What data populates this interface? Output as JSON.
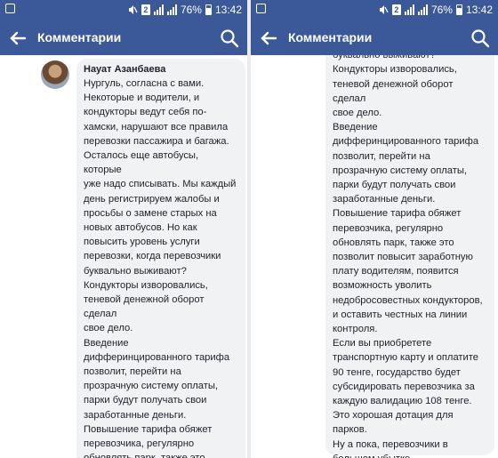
{
  "status": {
    "battery": "76%",
    "time": "13:42",
    "sim_label": "2"
  },
  "appbar": {
    "title": "Комментарии"
  },
  "icons": {
    "back": "arrow-back-icon",
    "search": "search-icon"
  },
  "colors": {
    "bar": "#3b5998",
    "bubble": "#f1f2f4",
    "text": "#1d2129"
  },
  "comment": {
    "author": "Науат Азанбаева",
    "left_text": "Нургуль, согласна с вами.\nНекоторые и водители, и\nкондукторы ведут себя по-\nхамски, нарушают все правила\nперевозки пассажира и багажа.\nОсталось еще автобусы, которые\nуже надо списывать. Мы каждый\nдень регистрируем жалобы и\nпросьбы о замене старых на\nновых автобусов. Но как\nповысить уровень услуги\nперевозки, когда перевозчики\nбуквально выживают?\nКондукторы изворовались,\nтеневой денежной оборот сделал\nсвое дело.\nВведение\nдифферинцированного тарифа\nпозволит, перейти на\nпрозрачную систему оплаты,\nпарки будут получать свои\nзаработанные деньги.\nПовышение тарифа обяжет\nперевозчика, регулярно\nобновлять парк, также это\nпозволит повысит заработную",
    "right_text": "перевозки, когда перевозчики\nбуквально выживают?\nКондукторы изворовались,\nтеневой денежной оборот сделал\nсвое дело.\nВведение\nдифферинцированного тарифа\nпозволит, перейти на\nпрозрачную систему оплаты,\nпарки будут получать свои\nзаработанные деньги.\nПовышение тарифа обяжет\nперевозчика, регулярно\nобновлять парк, также это\nпозволит повысит заработную\nплату водителям, появится\nвозможность уволить\nнедобросовестных кондукторов,\nи оставить честных на линии\nконтроля.\nЕсли вы приобретете\nтранспортную карту и оплатите\n90 тенге, государство будет\nсубсидировать перевозчика за\nкаждую валидацию 108 тенге.\nЭто хорошая дотация для парков.\nНу а пока, перевозчики в\nбольшом убытке."
  }
}
